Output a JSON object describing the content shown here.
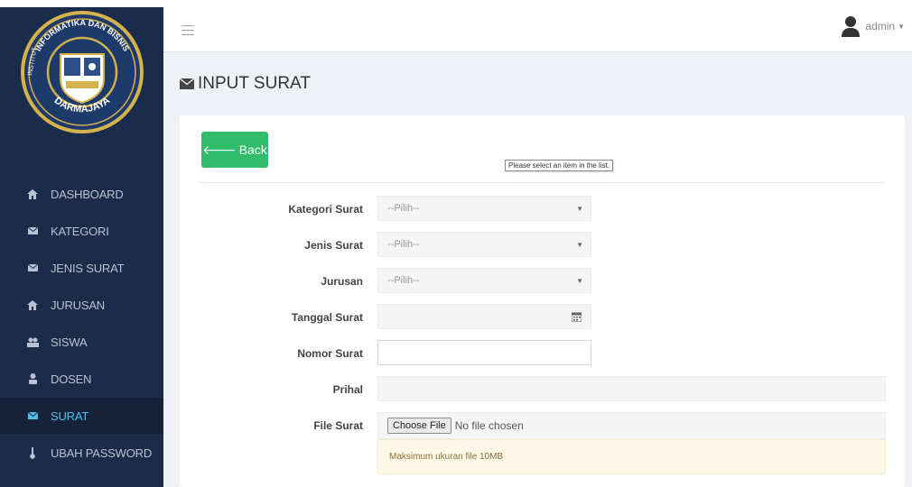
{
  "sidebar": {
    "logo": {
      "ring_text_top": "INFORMATIKA DAN BISNIS",
      "ring_text_left": "INSTITUT",
      "ring_text_bottom": "DARMAJAYA"
    },
    "items": [
      {
        "label": "DASHBOARD",
        "icon": "home-icon",
        "active": false
      },
      {
        "label": "KATEGORI",
        "icon": "envelope-icon",
        "active": false
      },
      {
        "label": "JENIS SURAT",
        "icon": "envelope-icon",
        "active": false
      },
      {
        "label": "JURUSAN",
        "icon": "home-icon",
        "active": false
      },
      {
        "label": "SISWA",
        "icon": "users-icon",
        "active": false
      },
      {
        "label": "DOSEN",
        "icon": "user-icon",
        "active": false
      },
      {
        "label": "SURAT",
        "icon": "envelope-icon",
        "active": true
      },
      {
        "label": "UBAH PASSWORD",
        "icon": "thermometer-icon",
        "active": false
      }
    ]
  },
  "topbar": {
    "user_label": "admin"
  },
  "page": {
    "title": "INPUT SURAT"
  },
  "form": {
    "back_label": "Back",
    "kategori": {
      "label": "Kategori Surat",
      "value": "--Pilih--"
    },
    "jenis": {
      "label": "Jenis Surat",
      "value": "--Pilih--"
    },
    "jurusan": {
      "label": "Jurusan",
      "value": "--Pilih--"
    },
    "tanggal": {
      "label": "Tanggal Surat",
      "value": ""
    },
    "nomor": {
      "label": "Nomor Surat",
      "value": ""
    },
    "prihal": {
      "label": "Prihal",
      "value": ""
    },
    "file": {
      "label": "File Surat",
      "button": "Choose File",
      "status": "No file chosen"
    },
    "note": "Maksimum ukuran file 10MB",
    "tooltip": "Please select an item in the list."
  },
  "colors": {
    "sidebar_bg": "#1a2c49",
    "active_item": "#4fc1e9",
    "back_button": "#2fbd6b"
  }
}
